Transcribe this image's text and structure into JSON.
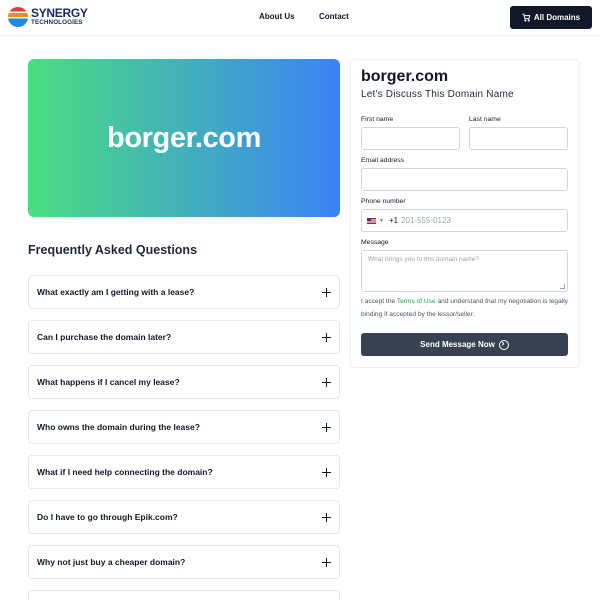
{
  "header": {
    "logo_name": "SYNERGY",
    "logo_sub": "TECHNOLOGIES",
    "nav": [
      "About Us",
      "Contact"
    ],
    "all_domains_label": "All Domains"
  },
  "hero": {
    "domain": "borger.com"
  },
  "faq": {
    "heading": "Frequently Asked Questions",
    "items": [
      "What exactly am I getting with a lease?",
      "Can I purchase the domain later?",
      "What happens if I cancel my lease?",
      "Who owns the domain during the lease?",
      "What if I need help connecting the domain?",
      "Do I have to go through Epik.com?",
      "Why not just buy a cheaper domain?"
    ]
  },
  "form": {
    "title": "borger.com",
    "subtitle": "Let's Discuss This Domain Name",
    "first_name_label": "First name",
    "last_name_label": "Last name",
    "email_label": "Email address",
    "phone_label": "Phone number",
    "phone_code": "+1",
    "phone_placeholder": "201-555-0123",
    "message_label": "Message",
    "message_placeholder": "What brings you to this domain name?",
    "terms_pre": "I accept the ",
    "terms_link": "Terms of Use",
    "terms_post": " and understand that my negotiation is legally binding if accepted by the lessor/seller.",
    "send_label": "Send Message Now"
  },
  "colors": {
    "dark": "#111827",
    "button": "#374151",
    "gradient_start": "#4ade80",
    "gradient_end": "#3b82f6",
    "link": "#16a34a"
  }
}
